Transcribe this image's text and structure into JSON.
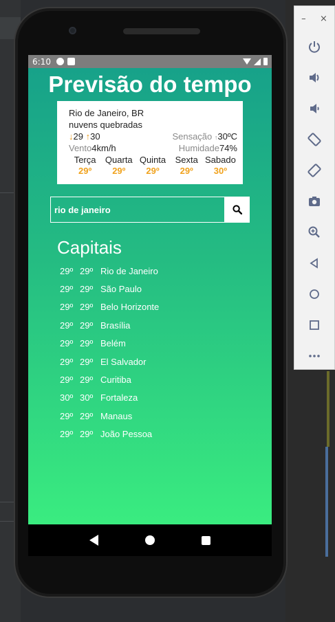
{
  "status_bar": {
    "time": "6:10"
  },
  "app": {
    "title": "Previsão do tempo",
    "card": {
      "city": "Rio de Janeiro, BR",
      "description": "nuvens quebradas",
      "min_arrow": "↓",
      "min": "29",
      "max_arrow": "↑",
      "max": "30",
      "feels_label": "Sensação",
      "feels_value": "30ºC",
      "wind_label": "Vento",
      "wind_value": "4km/h",
      "humidity_label": "Humidade",
      "humidity_value": "74%",
      "forecast": [
        {
          "day": "Terça",
          "temp": "29º"
        },
        {
          "day": "Quarta",
          "temp": "29º"
        },
        {
          "day": "Quinta",
          "temp": "29º"
        },
        {
          "day": "Sexta",
          "temp": "29º"
        },
        {
          "day": "Sabado",
          "temp": "30º"
        }
      ]
    },
    "search": {
      "value": "rio de janeiro"
    },
    "capitals_title": "Capitais",
    "capitals": [
      {
        "min": "29º",
        "max": "29º",
        "name": "Rio de Janeiro"
      },
      {
        "min": "29º",
        "max": "29º",
        "name": "São Paulo"
      },
      {
        "min": "29º",
        "max": "29º",
        "name": "Belo Horizonte"
      },
      {
        "min": "29º",
        "max": "29º",
        "name": "Brasília"
      },
      {
        "min": "29º",
        "max": "29º",
        "name": "Belém"
      },
      {
        "min": "29º",
        "max": "29º",
        "name": "El Salvador"
      },
      {
        "min": "29º",
        "max": "29º",
        "name": "Curitiba"
      },
      {
        "min": "30º",
        "max": "30º",
        "name": "Fortaleza"
      },
      {
        "min": "29º",
        "max": "29º",
        "name": "Manaus"
      },
      {
        "min": "29º",
        "max": "29º",
        "name": "João Pessoa"
      }
    ]
  },
  "emulator_panel": {
    "minimize": "–",
    "close": "×",
    "buttons": [
      "power-icon",
      "volume-up-icon",
      "volume-down-icon",
      "rotate-left-icon",
      "rotate-right-icon",
      "camera-icon",
      "zoom-icon",
      "back-icon",
      "home-icon",
      "overview-icon",
      "more-icon"
    ]
  },
  "colors": {
    "gradient_top": "#16a08a",
    "gradient_bottom": "#3aec80",
    "accent_orange": "#f0a21d",
    "emulator_icon": "#5f6b8a"
  }
}
